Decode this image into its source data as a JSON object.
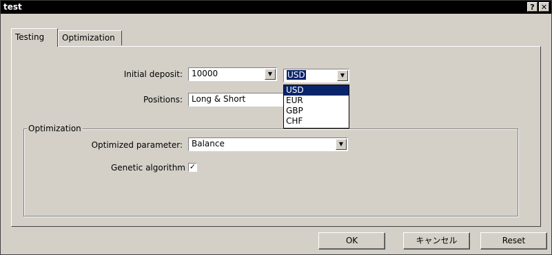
{
  "window": {
    "title": "test",
    "help_label": "?",
    "close_label": "✕"
  },
  "tabs": [
    {
      "label": "Testing"
    },
    {
      "label": "Optimization"
    }
  ],
  "testing": {
    "initial_deposit_label": "Initial deposit:",
    "initial_deposit_value": "10000",
    "currency_value": "USD",
    "currency_options": [
      "USD",
      "EUR",
      "GBP",
      "CHF"
    ],
    "positions_label": "Positions:",
    "positions_value": "Long & Short"
  },
  "optimization": {
    "group_title": "Optimization",
    "optimized_parameter_label": "Optimized parameter:",
    "optimized_parameter_value": "Balance",
    "genetic_label": "Genetic algorithm",
    "genetic_checked": true,
    "check_mark": "✓"
  },
  "buttons": {
    "ok": "OK",
    "cancel": "キャンセル",
    "reset": "Reset"
  },
  "colors": {
    "titlebar": "#000000",
    "selection": "#0a246a",
    "face": "#d4d0c8"
  }
}
